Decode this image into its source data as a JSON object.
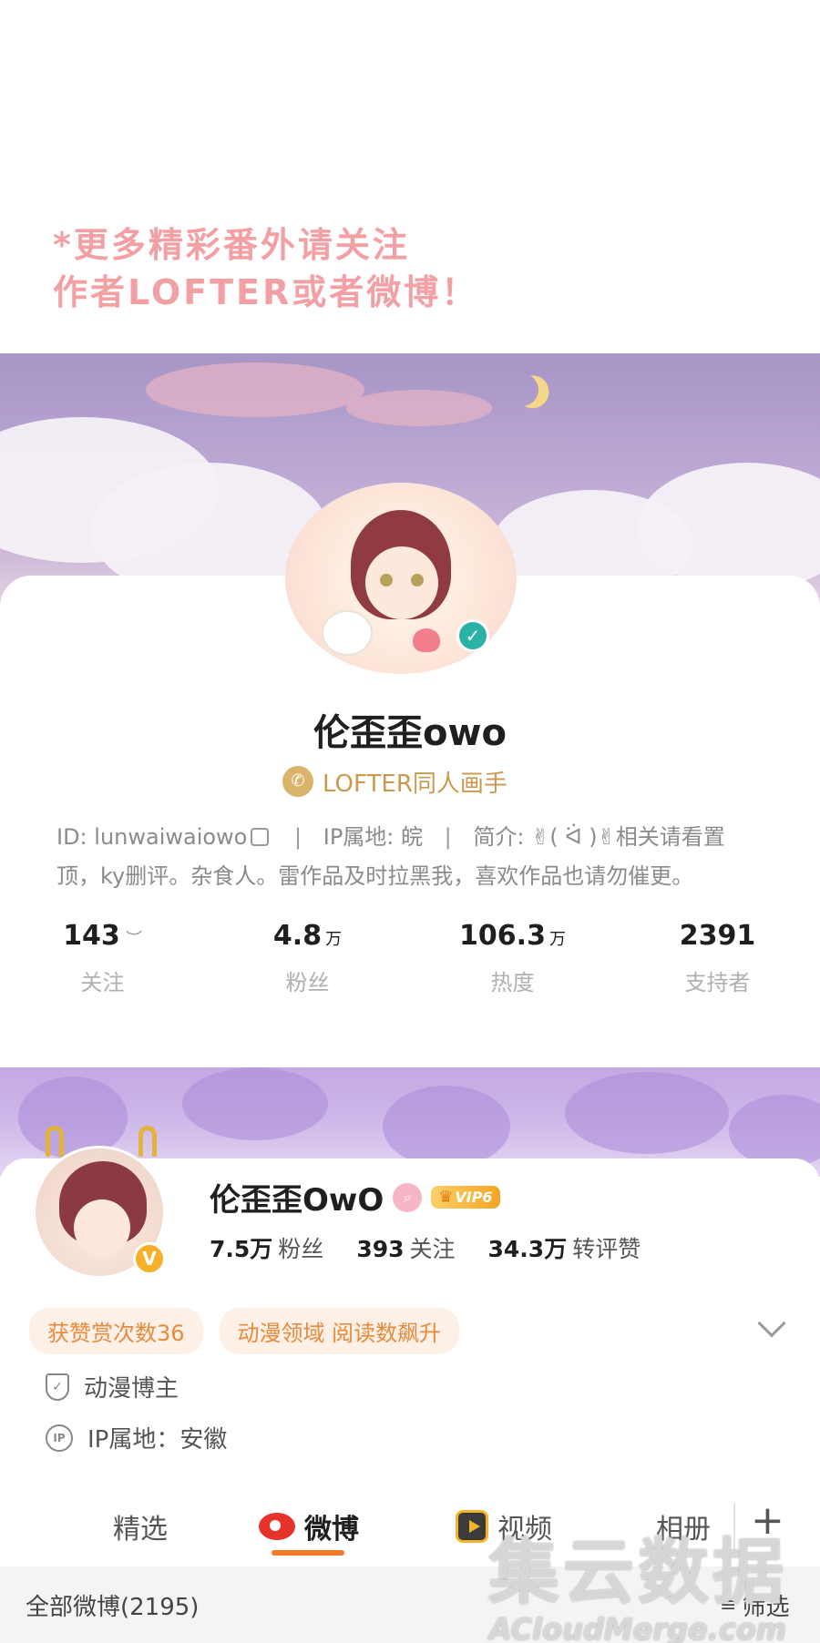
{
  "promo": {
    "line1": "*更多精彩番外请关注",
    "line2": "作者LOFTER或者微博！"
  },
  "lofter": {
    "name": "伦歪歪owo",
    "tag": "LOFTER同人画手",
    "tag_icon": "phone-icon",
    "verified_icon": "check-icon",
    "id_text": "ID: lunwaiwaiowo",
    "sep": "|",
    "ip_text": "IP属地:   皖",
    "bio_text": "简介: ✌︎( ᐛ )✌︎相关请看置顶，ky删评。杂食人。雷作品及时拉黑我，喜欢作品也请勿催更。",
    "stats": [
      {
        "num": "143",
        "unit": "",
        "label": "关注"
      },
      {
        "num": "4.8",
        "unit": "万",
        "label": "粉丝"
      },
      {
        "num": "106.3",
        "unit": "万",
        "label": "热度"
      },
      {
        "num": "2391",
        "unit": "",
        "label": "支持者"
      }
    ]
  },
  "weibo": {
    "name": "伦歪歪OwO",
    "vip": "VIP6",
    "stats": [
      {
        "num": "7.5万",
        "label": "粉丝"
      },
      {
        "num": "393",
        "label": "关注"
      },
      {
        "num": "34.3万",
        "label": "转评赞"
      }
    ],
    "chips": [
      "获赞赏次数36",
      "动漫领域 阅读数飙升"
    ],
    "role": "动漫博主",
    "ip": "IP属地：安徽",
    "tabs": [
      "精选",
      "微博",
      "视频",
      "相册"
    ],
    "plus": "+",
    "filter_label": "全部微博(2195)",
    "filter_button": "筛选",
    "filter_icon": "≡"
  },
  "watermark": {
    "line1": "集云数据",
    "line2": "ACloudMerge.com"
  },
  "colors": {
    "accent_orange": "#f27b29",
    "lofter_gold": "#c99a4e",
    "promo_pink": "#f3a0a5"
  }
}
